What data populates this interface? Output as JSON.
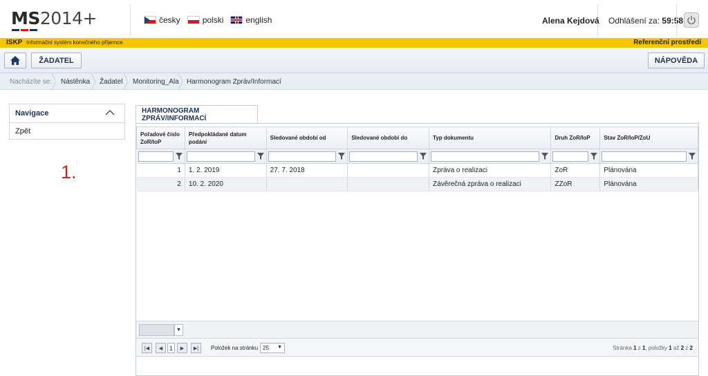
{
  "header": {
    "logo_bold": "MS",
    "logo_light": "2014+",
    "languages": [
      {
        "label": "česky",
        "icon": "czech-flag-icon"
      },
      {
        "label": "polski",
        "icon": "polish-flag-icon"
      },
      {
        "label": "english",
        "icon": "english-flag-icon"
      }
    ],
    "user_name": "Alena Kejdová",
    "logout_label": "Odhlášení za:",
    "logout_timer": "59:58",
    "power_icon": "power-icon"
  },
  "system_bar": {
    "code": "ISKP",
    "name": "Informační systém konečného příjemce",
    "environment": "Referenční prostředí",
    "color": "#f7c600"
  },
  "toolbar": {
    "home_icon": "home-icon",
    "zadatel_label": "ŽADATEL",
    "help_label": "NÁPOVĚDA"
  },
  "breadcrumb": {
    "lead": "Nacházíte se:",
    "items": [
      "Nástěnka",
      "Žadatel",
      "Monitoring_Ala",
      "Harmonogram Zpráv/Informací"
    ]
  },
  "navigation": {
    "title": "Navigace",
    "items": [
      "Zpět"
    ]
  },
  "annotation": "1.",
  "tab": {
    "label": "HARMONOGRAM ZPRÁV/INFORMACÍ"
  },
  "grid": {
    "columns": [
      "Pořadové číslo ZoR/IoP",
      "Předpokládané datum podání",
      "Sledované období od",
      "Sledované období do",
      "Typ dokumentu",
      "Druh ZoR/IoP",
      "Stav ZoR/IoP/ZoU"
    ],
    "rows": [
      [
        "1",
        "1. 2. 2019",
        "27. 7. 2018",
        "",
        "Zpráva o realizaci",
        "ZoR",
        "Plánována"
      ],
      [
        "2",
        "10. 2. 2020",
        "",
        "",
        "Závěrečná zpráva o realizaci",
        "ZZoR",
        "Plánována"
      ]
    ]
  },
  "pager": {
    "current_page": "1",
    "page_size_label": "Položek na stránku",
    "page_size": "25",
    "info_prefix": "Stránka",
    "info_page": "1",
    "info_of": "z",
    "info_pages": "1",
    "info_items": ", položky",
    "info_from": "1",
    "info_to_word": "až",
    "info_to": "2",
    "info_of2": "z",
    "info_total": "2"
  }
}
